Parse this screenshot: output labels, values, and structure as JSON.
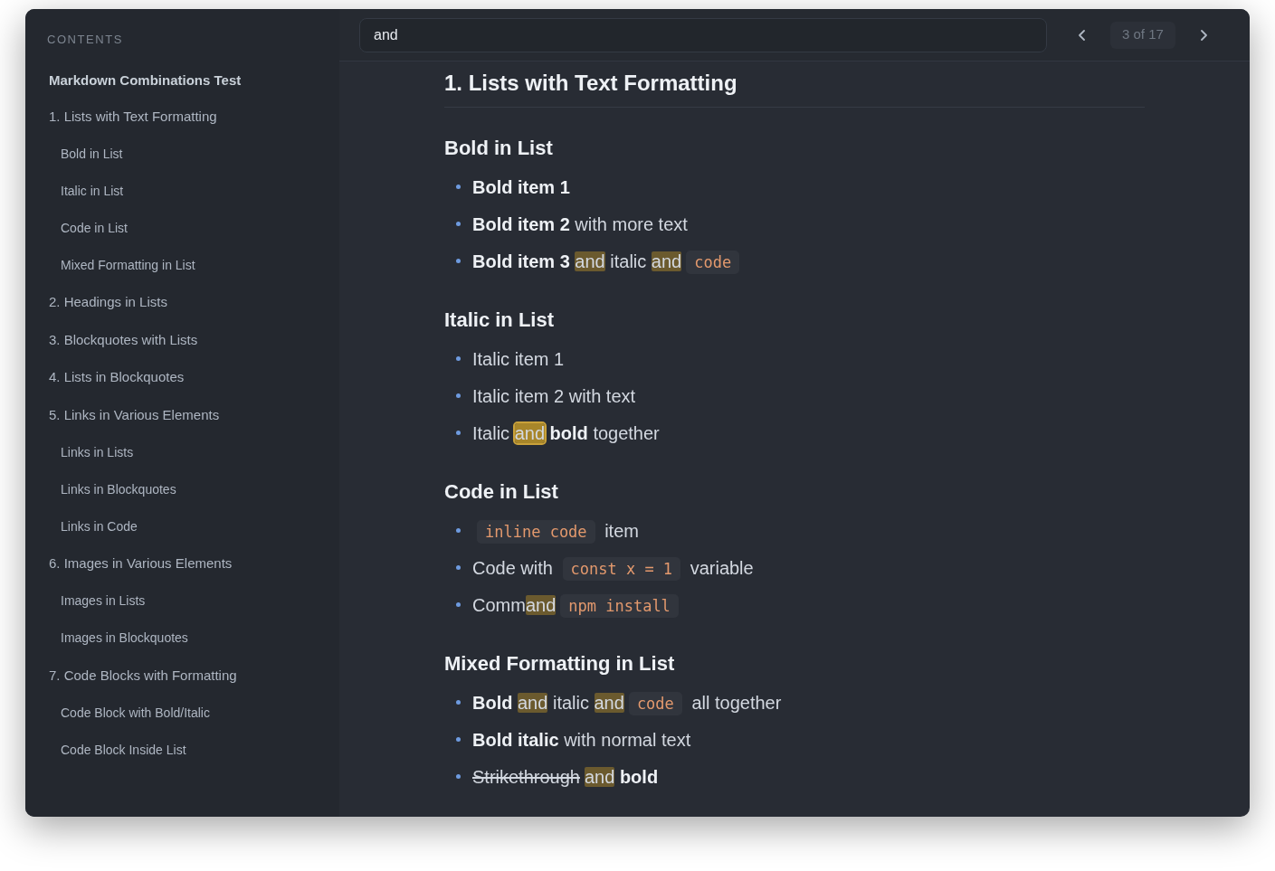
{
  "sidebar": {
    "title": "CONTENTS",
    "toc": [
      {
        "label": "Markdown Combinations Test",
        "children": [
          {
            "label": "1. Lists with Text Formatting",
            "children": [
              {
                "label": "Bold in List"
              },
              {
                "label": "Italic in List"
              },
              {
                "label": "Code in List"
              },
              {
                "label": "Mixed Formatting in List"
              }
            ]
          },
          {
            "label": "2. Headings in Lists"
          },
          {
            "label": "3. Blockquotes with Lists"
          },
          {
            "label": "4. Lists in Blockquotes"
          },
          {
            "label": "5. Links in Various Elements",
            "children": [
              {
                "label": "Links in Lists"
              },
              {
                "label": "Links in Blockquotes"
              },
              {
                "label": "Links in Code"
              }
            ]
          },
          {
            "label": "6. Images in Various Elements",
            "children": [
              {
                "label": "Images in Lists"
              },
              {
                "label": "Images in Blockquotes"
              }
            ]
          },
          {
            "label": "7. Code Blocks with Formatting",
            "children": [
              {
                "label": "Code Block with Bold/Italic"
              },
              {
                "label": "Code Block Inside List"
              }
            ]
          }
        ]
      }
    ]
  },
  "search": {
    "value": "and",
    "counter": "3 of 17"
  },
  "document": {
    "title": "1. Lists with Text Formatting",
    "sections": [
      {
        "heading": "Bold in List",
        "items": [
          [
            {
              "kind": "bold",
              "text": "Bold item 1"
            }
          ],
          [
            {
              "kind": "bold",
              "text": "Bold item 2"
            },
            {
              "kind": "text",
              "text": " with more text"
            }
          ],
          [
            {
              "kind": "bold",
              "text": "Bold item 3 "
            },
            {
              "kind": "match",
              "text": "and"
            },
            {
              "kind": "text",
              "text": " italic "
            },
            {
              "kind": "match",
              "text": "and"
            },
            {
              "kind": "code",
              "text": "code"
            }
          ]
        ]
      },
      {
        "heading": "Italic in List",
        "items": [
          [
            {
              "kind": "text",
              "text": "Italic item 1"
            }
          ],
          [
            {
              "kind": "text",
              "text": "Italic item 2 with text"
            }
          ],
          [
            {
              "kind": "text",
              "text": "Italic "
            },
            {
              "kind": "current",
              "text": "and"
            },
            {
              "kind": "bold",
              "text": " bold"
            },
            {
              "kind": "text",
              "text": " together"
            }
          ]
        ]
      },
      {
        "heading": "Code in List",
        "items": [
          [
            {
              "kind": "code",
              "text": "inline code"
            },
            {
              "kind": "text",
              "text": " item"
            }
          ],
          [
            {
              "kind": "text",
              "text": "Code with "
            },
            {
              "kind": "code",
              "text": "const x = 1"
            },
            {
              "kind": "text",
              "text": " variable"
            }
          ],
          [
            {
              "kind": "text",
              "text": "Comm"
            },
            {
              "kind": "match",
              "text": "and"
            },
            {
              "kind": "code",
              "text": "npm install"
            }
          ]
        ]
      },
      {
        "heading": "Mixed Formatting in List",
        "items": [
          [
            {
              "kind": "bold",
              "text": "Bold "
            },
            {
              "kind": "match",
              "text": "and"
            },
            {
              "kind": "text",
              "text": " italic "
            },
            {
              "kind": "match",
              "text": "and"
            },
            {
              "kind": "code",
              "text": "code"
            },
            {
              "kind": "text",
              "text": " all together"
            }
          ],
          [
            {
              "kind": "bold",
              "text": "Bold italic"
            },
            {
              "kind": "text",
              "text": " with normal text"
            }
          ],
          [
            {
              "kind": "strike",
              "text": "Strikethrough"
            },
            {
              "kind": "match",
              "text": "and"
            },
            {
              "kind": "bold",
              "text": " bold"
            }
          ]
        ]
      }
    ]
  }
}
